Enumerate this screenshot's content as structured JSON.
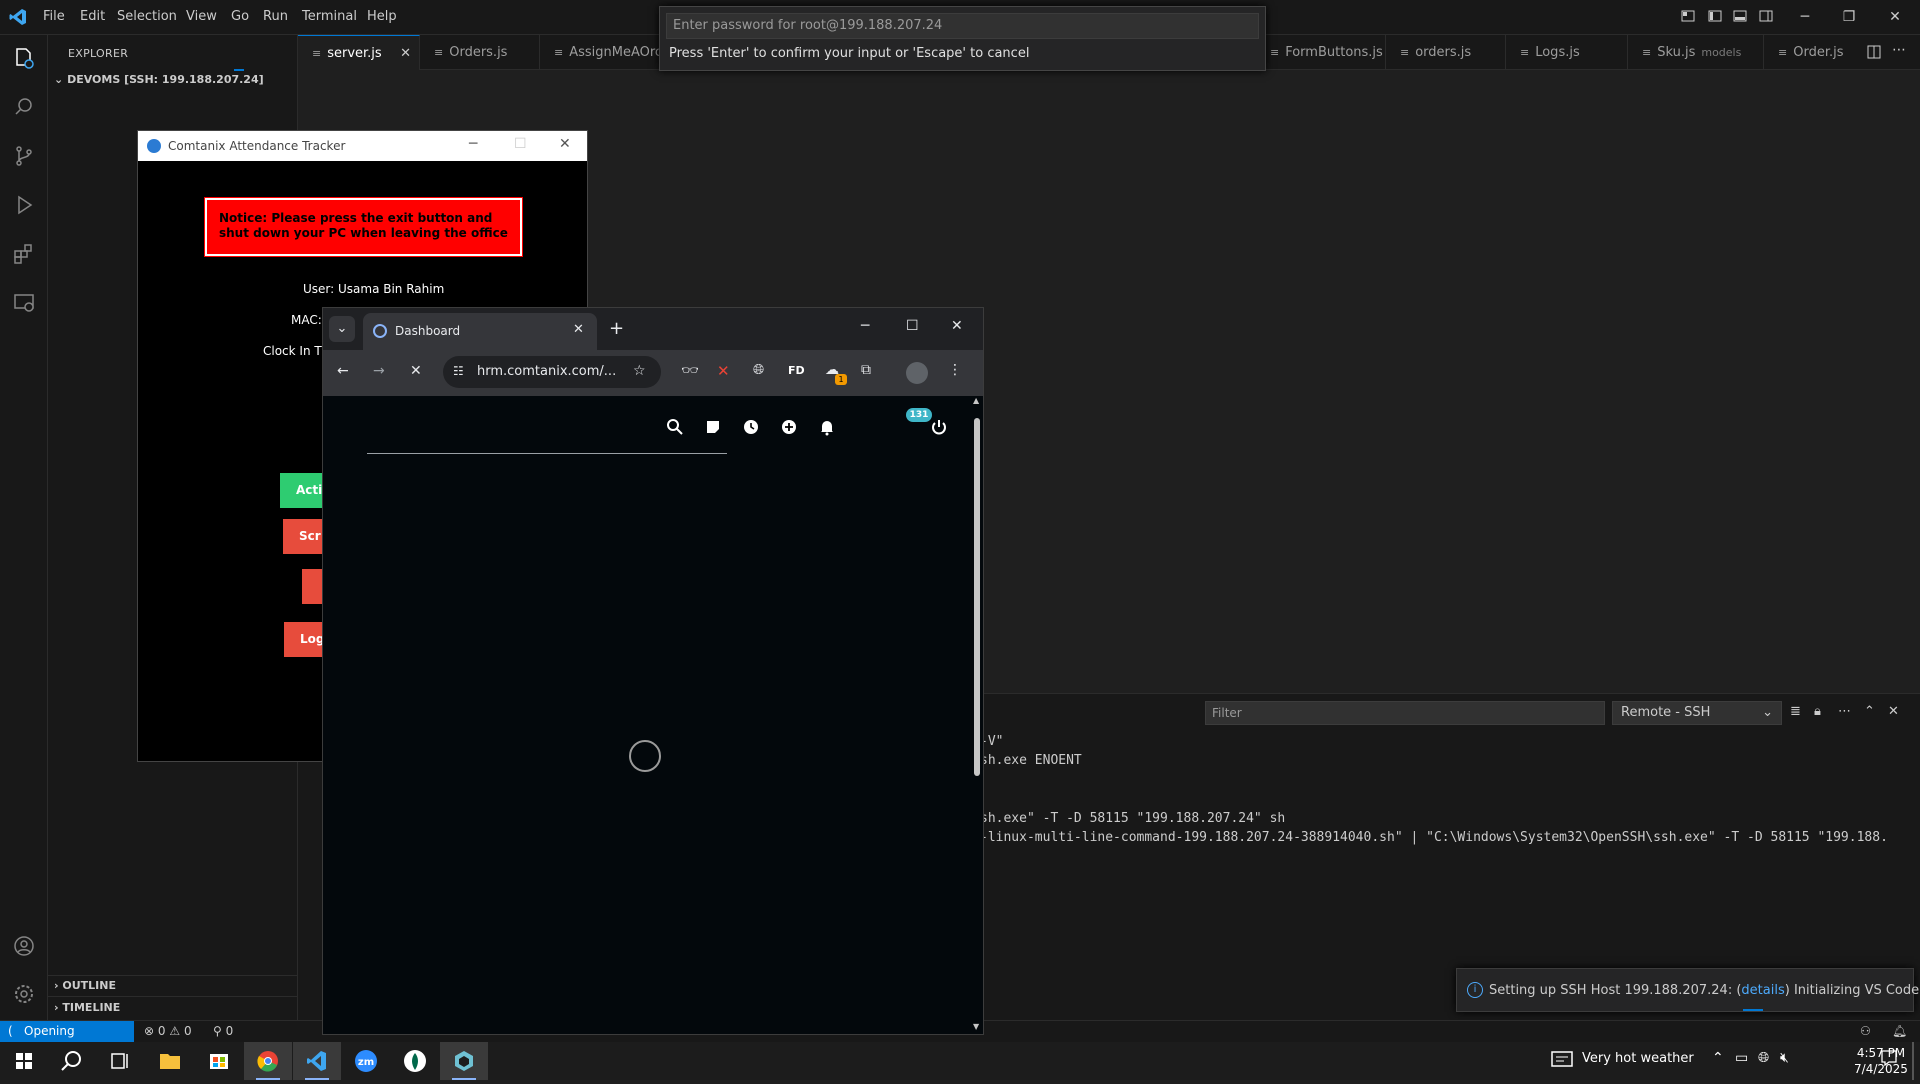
{
  "vscode": {
    "menu": [
      "File",
      "Edit",
      "Selection",
      "View",
      "Go",
      "Run",
      "Terminal",
      "Help"
    ],
    "quick_input": {
      "placeholder": "Enter password for root@199.188.207.24",
      "message": "Press 'Enter' to confirm your input or 'Escape' to cancel"
    },
    "sidebar": {
      "title": "EXPLORER",
      "workspace": "DEVOMS [SSH: 199.188.207.24]",
      "outline": "OUTLINE",
      "timeline": "TIMELINE"
    },
    "tabs": [
      {
        "label": "server.js",
        "active": true,
        "close": "✕"
      },
      {
        "label": "Orders.js"
      },
      {
        "label": "AssignMeAOrc"
      },
      {
        "label": "FormButtons.js"
      },
      {
        "label": "orders.js"
      },
      {
        "label": "Logs.js"
      },
      {
        "label": "Sku.js",
        "suffix": "models"
      },
      {
        "label": "Order.js"
      }
    ],
    "panel": {
      "filter_placeholder": "Filter",
      "source": "Remote - SSH",
      "lines": [
        "-V\"",
        "sh.exe ENOENT",
        "",
        "",
        "",
        "sh.exe\" -T -D 58115 \"199.188.207.24\" sh",
        "-linux-multi-line-command-199.188.207.24-388914040.sh\" | \"C:\\Windows\\System32\\OpenSSH\\ssh.exe\" -T -D 58115 \"199.188."
      ]
    },
    "notification": {
      "prefix": "Setting up SSH Host 199.188.207.24: (",
      "link": "details",
      "suffix": ") Initializing VS Code Server"
    },
    "statusbar": {
      "remote": "Opening Remote...",
      "errors": "0",
      "warnings": "0",
      "ports": "0"
    }
  },
  "tracker": {
    "title": "Comtanix Attendance Tracker",
    "notice": "Notice: Please press the exit button and shut down your PC when leaving the office",
    "user": "User: Usama Bin Rahim",
    "mac": "MAC:",
    "clock_in": "Clock In Tir",
    "buttons": [
      "Acti",
      "Scr",
      "",
      "Log"
    ]
  },
  "chrome": {
    "tab_title": "Dashboard",
    "url": "hrm.comtanix.com/...",
    "notification_count": "131",
    "ext_badge": "1",
    "fd_label": "FD"
  },
  "taskbar": {
    "weather": "Very hot weather",
    "time": "4:57 PM",
    "date": "7/4/2025"
  },
  "colors": {
    "accent": "#0078d4",
    "notice_bg": "#ff0000",
    "green_button": "#2ecc71",
    "red_button": "#e74c3c",
    "badge": "#3fb6c8"
  }
}
